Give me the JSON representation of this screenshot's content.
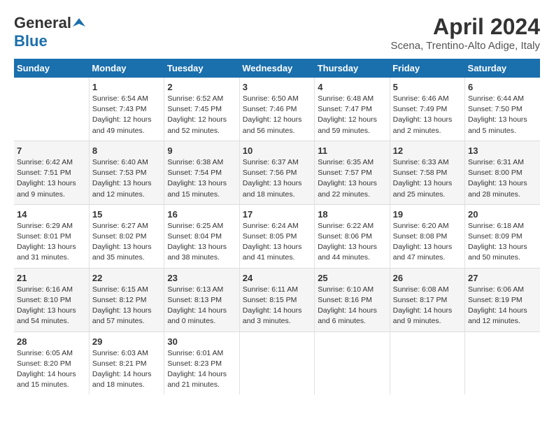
{
  "logo": {
    "general": "General",
    "blue": "Blue"
  },
  "title": "April 2024",
  "subtitle": "Scena, Trentino-Alto Adige, Italy",
  "headers": [
    "Sunday",
    "Monday",
    "Tuesday",
    "Wednesday",
    "Thursday",
    "Friday",
    "Saturday"
  ],
  "weeks": [
    [
      {
        "day": "",
        "info": ""
      },
      {
        "day": "1",
        "info": "Sunrise: 6:54 AM\nSunset: 7:43 PM\nDaylight: 12 hours\nand 49 minutes."
      },
      {
        "day": "2",
        "info": "Sunrise: 6:52 AM\nSunset: 7:45 PM\nDaylight: 12 hours\nand 52 minutes."
      },
      {
        "day": "3",
        "info": "Sunrise: 6:50 AM\nSunset: 7:46 PM\nDaylight: 12 hours\nand 56 minutes."
      },
      {
        "day": "4",
        "info": "Sunrise: 6:48 AM\nSunset: 7:47 PM\nDaylight: 12 hours\nand 59 minutes."
      },
      {
        "day": "5",
        "info": "Sunrise: 6:46 AM\nSunset: 7:49 PM\nDaylight: 13 hours\nand 2 minutes."
      },
      {
        "day": "6",
        "info": "Sunrise: 6:44 AM\nSunset: 7:50 PM\nDaylight: 13 hours\nand 5 minutes."
      }
    ],
    [
      {
        "day": "7",
        "info": "Sunrise: 6:42 AM\nSunset: 7:51 PM\nDaylight: 13 hours\nand 9 minutes."
      },
      {
        "day": "8",
        "info": "Sunrise: 6:40 AM\nSunset: 7:53 PM\nDaylight: 13 hours\nand 12 minutes."
      },
      {
        "day": "9",
        "info": "Sunrise: 6:38 AM\nSunset: 7:54 PM\nDaylight: 13 hours\nand 15 minutes."
      },
      {
        "day": "10",
        "info": "Sunrise: 6:37 AM\nSunset: 7:56 PM\nDaylight: 13 hours\nand 18 minutes."
      },
      {
        "day": "11",
        "info": "Sunrise: 6:35 AM\nSunset: 7:57 PM\nDaylight: 13 hours\nand 22 minutes."
      },
      {
        "day": "12",
        "info": "Sunrise: 6:33 AM\nSunset: 7:58 PM\nDaylight: 13 hours\nand 25 minutes."
      },
      {
        "day": "13",
        "info": "Sunrise: 6:31 AM\nSunset: 8:00 PM\nDaylight: 13 hours\nand 28 minutes."
      }
    ],
    [
      {
        "day": "14",
        "info": "Sunrise: 6:29 AM\nSunset: 8:01 PM\nDaylight: 13 hours\nand 31 minutes."
      },
      {
        "day": "15",
        "info": "Sunrise: 6:27 AM\nSunset: 8:02 PM\nDaylight: 13 hours\nand 35 minutes."
      },
      {
        "day": "16",
        "info": "Sunrise: 6:25 AM\nSunset: 8:04 PM\nDaylight: 13 hours\nand 38 minutes."
      },
      {
        "day": "17",
        "info": "Sunrise: 6:24 AM\nSunset: 8:05 PM\nDaylight: 13 hours\nand 41 minutes."
      },
      {
        "day": "18",
        "info": "Sunrise: 6:22 AM\nSunset: 8:06 PM\nDaylight: 13 hours\nand 44 minutes."
      },
      {
        "day": "19",
        "info": "Sunrise: 6:20 AM\nSunset: 8:08 PM\nDaylight: 13 hours\nand 47 minutes."
      },
      {
        "day": "20",
        "info": "Sunrise: 6:18 AM\nSunset: 8:09 PM\nDaylight: 13 hours\nand 50 minutes."
      }
    ],
    [
      {
        "day": "21",
        "info": "Sunrise: 6:16 AM\nSunset: 8:10 PM\nDaylight: 13 hours\nand 54 minutes."
      },
      {
        "day": "22",
        "info": "Sunrise: 6:15 AM\nSunset: 8:12 PM\nDaylight: 13 hours\nand 57 minutes."
      },
      {
        "day": "23",
        "info": "Sunrise: 6:13 AM\nSunset: 8:13 PM\nDaylight: 14 hours\nand 0 minutes."
      },
      {
        "day": "24",
        "info": "Sunrise: 6:11 AM\nSunset: 8:15 PM\nDaylight: 14 hours\nand 3 minutes."
      },
      {
        "day": "25",
        "info": "Sunrise: 6:10 AM\nSunset: 8:16 PM\nDaylight: 14 hours\nand 6 minutes."
      },
      {
        "day": "26",
        "info": "Sunrise: 6:08 AM\nSunset: 8:17 PM\nDaylight: 14 hours\nand 9 minutes."
      },
      {
        "day": "27",
        "info": "Sunrise: 6:06 AM\nSunset: 8:19 PM\nDaylight: 14 hours\nand 12 minutes."
      }
    ],
    [
      {
        "day": "28",
        "info": "Sunrise: 6:05 AM\nSunset: 8:20 PM\nDaylight: 14 hours\nand 15 minutes."
      },
      {
        "day": "29",
        "info": "Sunrise: 6:03 AM\nSunset: 8:21 PM\nDaylight: 14 hours\nand 18 minutes."
      },
      {
        "day": "30",
        "info": "Sunrise: 6:01 AM\nSunset: 8:23 PM\nDaylight: 14 hours\nand 21 minutes."
      },
      {
        "day": "",
        "info": ""
      },
      {
        "day": "",
        "info": ""
      },
      {
        "day": "",
        "info": ""
      },
      {
        "day": "",
        "info": ""
      }
    ]
  ]
}
